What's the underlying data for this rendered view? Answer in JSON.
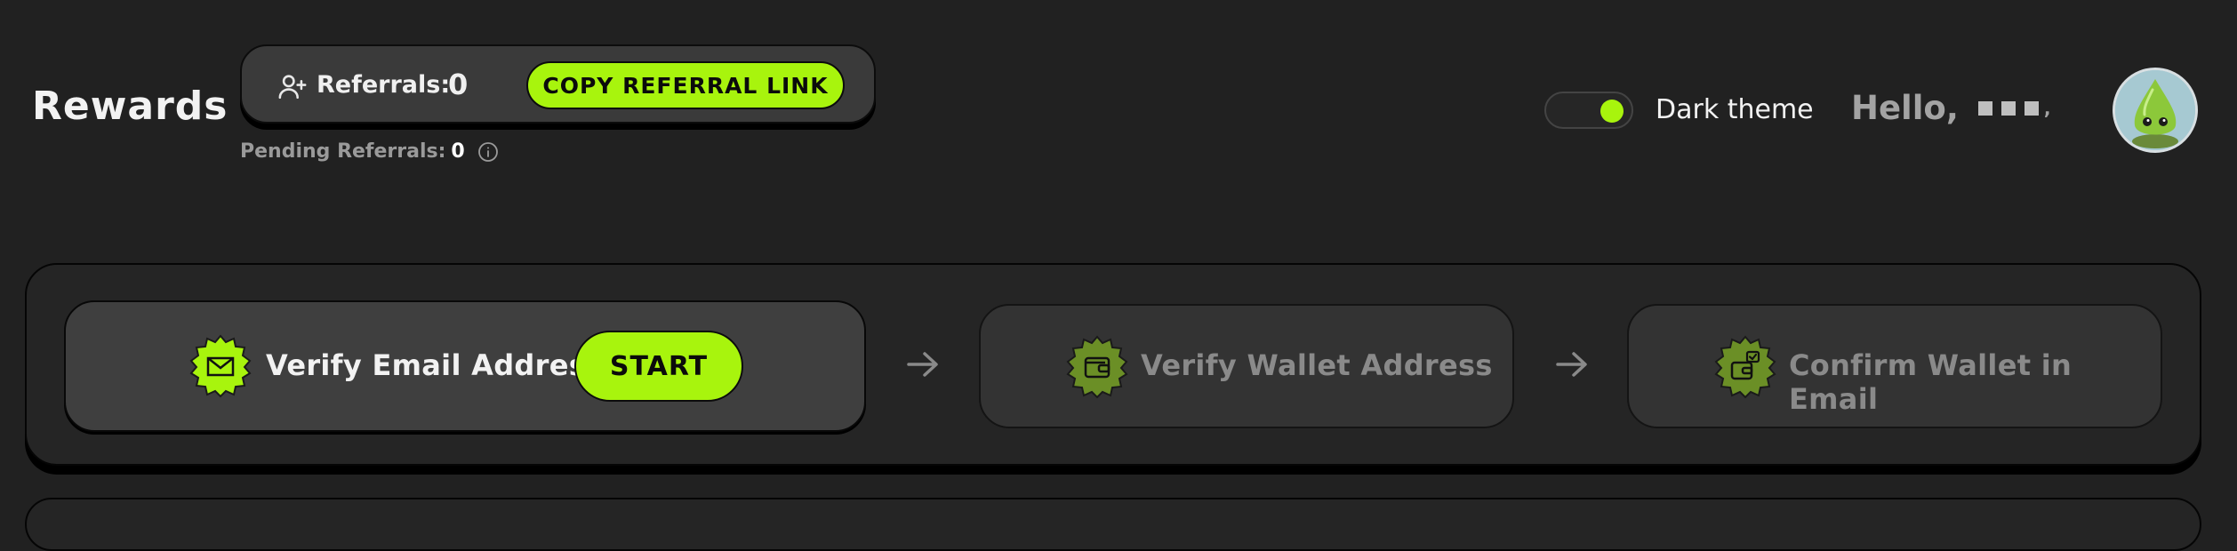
{
  "header": {
    "title": "Rewards",
    "referrals_label": "Referrals:",
    "referrals_count": "0",
    "copy_button": "COPY REFERRAL LINK",
    "pending_label": "Pending Referrals:",
    "pending_count": "0",
    "theme_label": "Dark theme",
    "theme_enabled": true,
    "greeting": "Hello,"
  },
  "steps": [
    {
      "label": "Verify Email Address",
      "icon": "envelope-icon",
      "active": true,
      "action": "START"
    },
    {
      "label": "Verify Wallet Address",
      "icon": "wallet-icon",
      "active": false
    },
    {
      "label": "Confirm Wallet in Email",
      "icon": "wallet-check-icon",
      "active": false
    }
  ],
  "colors": {
    "accent": "#a8f40d",
    "accent_dim": "#6b8f26",
    "background": "#212121",
    "card": "#252525"
  }
}
